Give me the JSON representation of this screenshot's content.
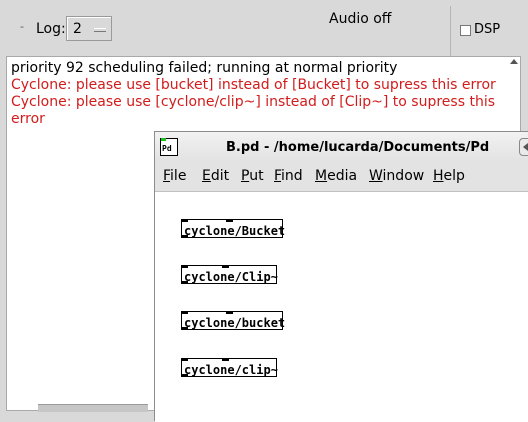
{
  "main_window": {
    "toolbar": {
      "log_label": "Log:",
      "log_level": "2",
      "audio_status": "Audio off",
      "dsp_label": "DSP"
    },
    "console": {
      "lines": [
        {
          "text": "priority 92 scheduling failed; running at normal priority",
          "kind": "info"
        },
        {
          "text": "Cyclone: please use [bucket] instead of [Bucket] to supress this error",
          "kind": "error"
        },
        {
          "text": "Cyclone: please use [cyclone/clip~] instead of [Clip~] to supress this error",
          "kind": "error"
        }
      ]
    }
  },
  "patch_window": {
    "icon_text": "Pd",
    "title": "B.pd  - /home/lucarda/Documents/Pd",
    "menu": [
      {
        "mnemonic": "F",
        "rest": "ile"
      },
      {
        "mnemonic": "E",
        "rest": "dit"
      },
      {
        "mnemonic": "P",
        "rest": "ut"
      },
      {
        "mnemonic": "F",
        "rest": "ind"
      },
      {
        "mnemonic": "M",
        "rest": "edia"
      },
      {
        "mnemonic": "W",
        "rest": "indow"
      },
      {
        "mnemonic": "H",
        "rest": "elp"
      }
    ],
    "objects": [
      {
        "text": "cyclone/Bucket"
      },
      {
        "text": "cyclone/Clip~"
      },
      {
        "text": "cyclone/bucket"
      },
      {
        "text": "cyclone/clip~"
      }
    ]
  },
  "colors": {
    "error_text": "#d21c1c",
    "window_bg": "#d9d9d9",
    "pd_icon_inlet": "#1cbf1c"
  }
}
